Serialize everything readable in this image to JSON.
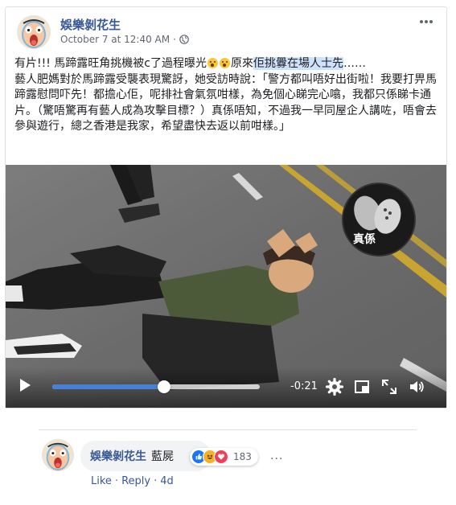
{
  "post": {
    "page_name": "娛樂剝花生",
    "timestamp": "October 7 at 12:40 AM",
    "separator": "·",
    "text_line1_a": "有片!!! 馬蹄露旺角挑機被c了過程曝光",
    "text_line1_b": "原來",
    "text_line1_highlight": "佢挑釁在場人士先",
    "text_line1_c": "……",
    "text_body": "藝人肥媽對於馬蹄露受襲表現驚訝，她受訪時說：「警方都叫唔好出街啦！我要打畀馬蹄露慰問吓先！都擔心佢，呢排社會氣氛咁樣，為免個心睇完心噏，我都只係睇卡通片。（驚唔驚再有藝人成為攻擊目標？）真係唔知，不過我一早同屋企人講咗，唔會去參與遊行，總之香港是我家，希望盡快去返以前咁樣。」"
  },
  "video": {
    "watermark_label": "真係",
    "time_remaining": "-0:21",
    "progress": 0.54,
    "controls": [
      "play-icon",
      "settings-icon",
      "pip-icon",
      "fullscreen-icon",
      "volume-icon"
    ]
  },
  "comment": {
    "author": "娛樂剝花生",
    "text": "藍屍",
    "reaction_count": "183",
    "reactions": [
      "like",
      "haha",
      "love"
    ],
    "more": "···",
    "actions": {
      "like": "Like",
      "dot1": "·",
      "reply": "Reply",
      "dot2": "·",
      "age": "4d"
    }
  },
  "colors": {
    "link": "#385898",
    "highlight": "#cfe2fb",
    "progress": "#4a7fd6",
    "like": "#1877f2",
    "love": "#f33e58",
    "haha": "#f7b125"
  }
}
